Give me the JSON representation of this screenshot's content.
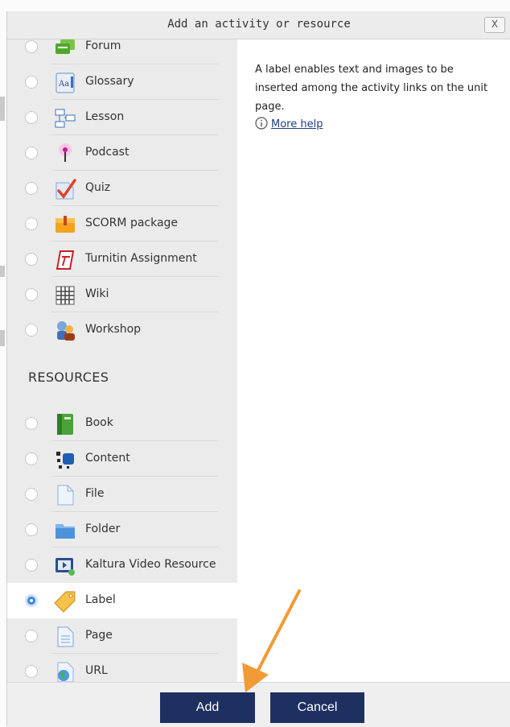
{
  "dialog": {
    "title": "Add an activity or resource",
    "close_label": "X"
  },
  "activities": [
    {
      "label": "Forum",
      "icon": "forum-icon"
    },
    {
      "label": "Glossary",
      "icon": "glossary-icon"
    },
    {
      "label": "Lesson",
      "icon": "lesson-icon"
    },
    {
      "label": "Podcast",
      "icon": "podcast-icon"
    },
    {
      "label": "Quiz",
      "icon": "quiz-icon"
    },
    {
      "label": "SCORM package",
      "icon": "scorm-icon"
    },
    {
      "label": "Turnitin Assignment",
      "icon": "turnitin-icon"
    },
    {
      "label": "Wiki",
      "icon": "wiki-icon"
    },
    {
      "label": "Workshop",
      "icon": "workshop-icon"
    }
  ],
  "resources_heading": "RESOURCES",
  "resources": [
    {
      "label": "Book",
      "icon": "book-icon"
    },
    {
      "label": "Content",
      "icon": "content-icon"
    },
    {
      "label": "File",
      "icon": "file-icon"
    },
    {
      "label": "Folder",
      "icon": "folder-icon"
    },
    {
      "label": "Kaltura Video Resource",
      "icon": "kaltura-icon"
    },
    {
      "label": "Label",
      "icon": "label-icon",
      "selected": true
    },
    {
      "label": "Page",
      "icon": "page-icon"
    },
    {
      "label": "URL",
      "icon": "url-icon"
    }
  ],
  "help": {
    "description": "A label enables text and images to be inserted among the activity links on the unit page.",
    "more_help": "More help",
    "info_icon": "info-icon"
  },
  "buttons": {
    "add": "Add",
    "cancel": "Cancel"
  },
  "colors": {
    "button_bg": "#1d3060",
    "selected_radio": "#3a86e0",
    "arrow": "#f29a33",
    "link": "#1d3f7e"
  }
}
